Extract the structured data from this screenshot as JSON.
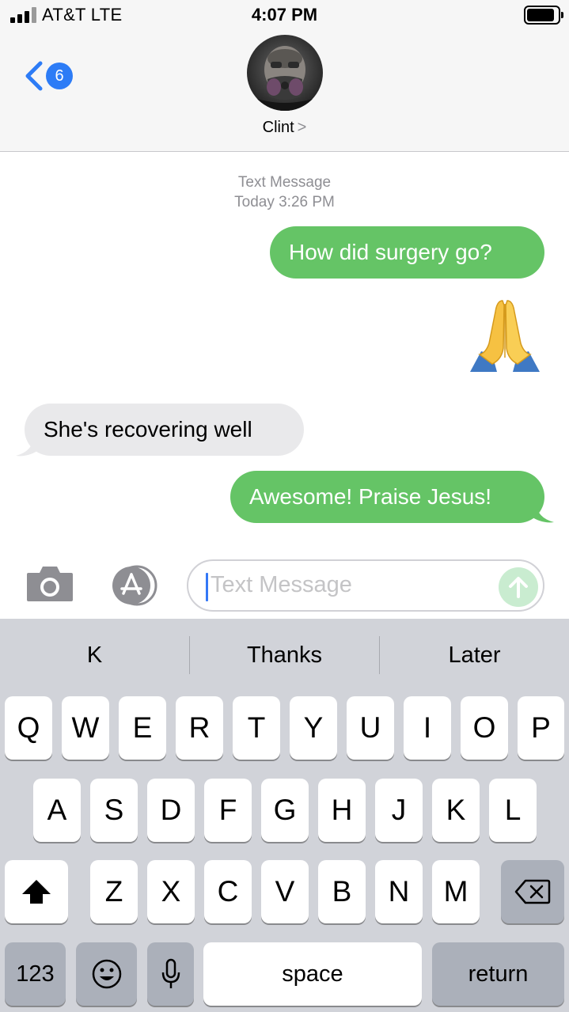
{
  "status_bar": {
    "carrier": "AT&T  LTE",
    "time": "4:07 PM",
    "battery_level": 0.9
  },
  "nav": {
    "back_count": "6",
    "contact_name": "Clint",
    "contact_chevron": ">"
  },
  "thread": {
    "service_label": "Text Message",
    "timestamp": "Today 3:26 PM",
    "messages": [
      {
        "direction": "sent",
        "text": "How did surgery go?"
      },
      {
        "direction": "sent",
        "emoji": "folded-hands"
      },
      {
        "direction": "received",
        "text": "She's recovering well"
      },
      {
        "direction": "sent",
        "text": "Awesome! Praise Jesus!"
      }
    ]
  },
  "composer": {
    "placeholder": "Text Message",
    "value": ""
  },
  "keyboard": {
    "suggestions": [
      "K",
      "Thanks",
      "Later"
    ],
    "row1": [
      "Q",
      "W",
      "E",
      "R",
      "T",
      "Y",
      "U",
      "I",
      "O",
      "P"
    ],
    "row2": [
      "A",
      "S",
      "D",
      "F",
      "G",
      "H",
      "J",
      "K",
      "L"
    ],
    "row3": [
      "Z",
      "X",
      "C",
      "V",
      "B",
      "N",
      "M"
    ],
    "numbers_label": "123",
    "space_label": "space",
    "return_label": "return"
  },
  "colors": {
    "sent_bubble": "#65c466",
    "received_bubble": "#e9e9eb",
    "accent_blue": "#2d7cf6",
    "keyboard_bg": "#d1d3d9"
  }
}
